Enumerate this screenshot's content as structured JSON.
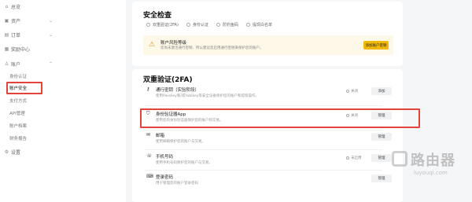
{
  "sidebar": {
    "items": [
      {
        "icon": "home-icon",
        "glyph": "⌂",
        "label": "总览"
      },
      {
        "icon": "wallet-icon",
        "glyph": "▣",
        "label": "资产",
        "chevron": "⌄"
      },
      {
        "icon": "orders-icon",
        "glyph": "▤",
        "label": "订单",
        "chevron": "⌄"
      },
      {
        "icon": "gift-icon",
        "glyph": "▦",
        "label": "奖励中心"
      },
      {
        "icon": "user-icon",
        "glyph": "♙",
        "label": "账户",
        "chevron": "⌃"
      }
    ],
    "sub_items": [
      "身份认证",
      "账户安全",
      "支付方式",
      "API管理",
      "账户档案",
      "财务报告"
    ],
    "settings": {
      "icon": "gear-icon",
      "glyph": "⚙",
      "label": "设置"
    }
  },
  "security_check": {
    "title": "安全检查",
    "statuses": [
      "双重验证(2FA)",
      "身份认证",
      "防钓鱼码",
      "提现白名单"
    ],
    "warning": {
      "title": "账户风险等级",
      "desc": "您尚未激活通行密钥、所以建议您启用通行密钥来保护您的账户。",
      "button": "添加账户密钥"
    }
  },
  "twofa": {
    "title": "双重验证(2FA)",
    "rows": [
      {
        "icon": "key-icon",
        "glyph": "⚷",
        "title": "通行密钥（实验阶段）",
        "desc": "使用Passkey和/或Yubikey等安全设备保护您的账户和提现操作。",
        "status": "关闭",
        "button": "添加"
      },
      {
        "icon": "authenticator-icon",
        "glyph": "⛉",
        "title": "身份验证器App",
        "desc": "使用您的身份验证器保护您的账户和交易。",
        "status": "关闭",
        "button": "管理"
      },
      {
        "icon": "mail-icon",
        "glyph": "✉",
        "title": "邮箱",
        "desc": "使用邮箱保护您的账户与交易。",
        "status": "",
        "button": "管理"
      },
      {
        "icon": "phone-icon",
        "glyph": "☏",
        "title": "手机号码",
        "desc": "使用手机号码保护您的账户与交易。",
        "status": "未启用",
        "button": "管理"
      },
      {
        "icon": "password-icon",
        "glyph": "⌨",
        "title": "登录密码",
        "desc": "用于管理您的账户登录密码",
        "status": "",
        "button": "管理"
      }
    ]
  },
  "watermark": {
    "text": "路由器",
    "sub": "luyouqi.com"
  },
  "colors": {
    "accent": "#f0b90b",
    "highlight": "#e2443c",
    "warning_bg": "#fdf8e8"
  }
}
